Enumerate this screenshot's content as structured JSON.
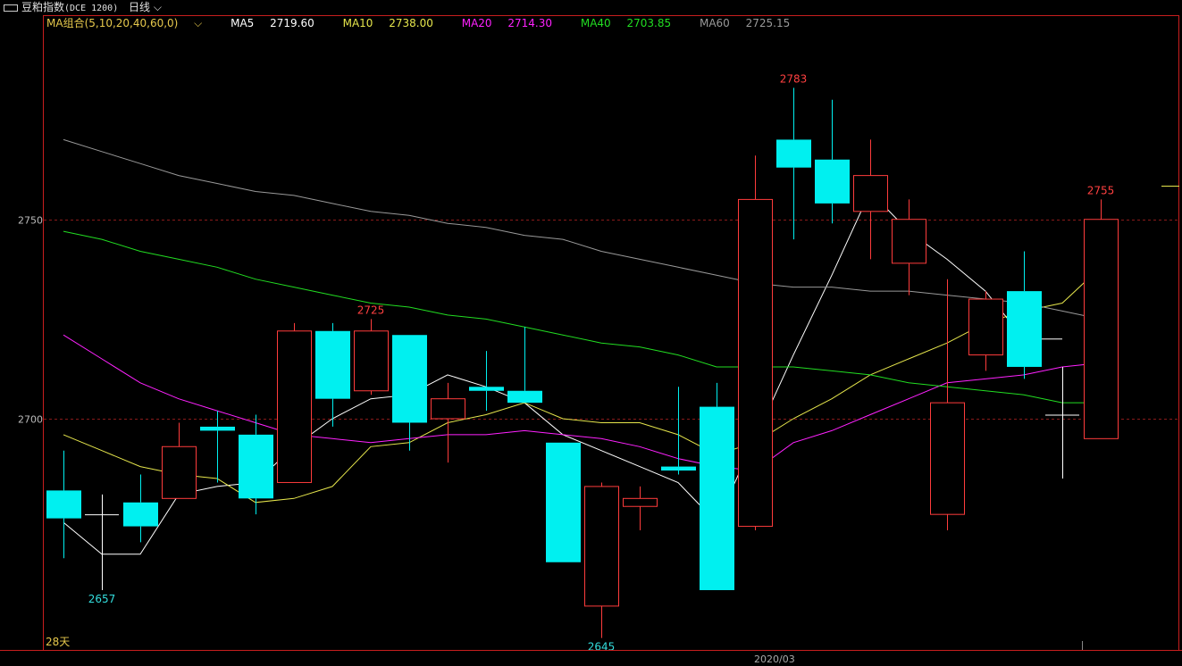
{
  "header": {
    "instrument": "豆粕指数",
    "code": "(DCE 1200)",
    "period": "日线"
  },
  "ma_legend": {
    "group_label": "MA组合(5,10,20,40,60,0)",
    "items": [
      {
        "label": "MA5",
        "value": "2719.60",
        "color": "#ffffff"
      },
      {
        "label": "MA10",
        "value": "2738.00",
        "color": "#e6e64c"
      },
      {
        "label": "MA20",
        "value": "2714.30",
        "color": "#ff22ff"
      },
      {
        "label": "MA40",
        "value": "2703.85",
        "color": "#22dd22"
      },
      {
        "label": "MA60",
        "value": "2725.15",
        "color": "#999999"
      }
    ]
  },
  "footer": {
    "days_label": "28天",
    "month_label": "2020/03"
  },
  "chart_data": {
    "type": "candlestick",
    "ylim": [
      2642,
      2801
    ],
    "yticks": [
      2700,
      2750
    ],
    "colors": {
      "up": "#ff3c3c",
      "down": "#00f0f0",
      "doji": "#ffffff",
      "grid": "#8a1a1a",
      "border": "#c81e1e"
    },
    "candles": [
      {
        "open": 2682,
        "high": 2692,
        "low": 2665,
        "close": 2675
      },
      {
        "open": 2676,
        "high": 2681,
        "low": 2657,
        "close": 2676
      },
      {
        "open": 2679,
        "high": 2686,
        "low": 2669,
        "close": 2673
      },
      {
        "open": 2680,
        "high": 2699,
        "low": 2680,
        "close": 2693
      },
      {
        "open": 2698,
        "high": 2702,
        "low": 2684,
        "close": 2697
      },
      {
        "open": 2696,
        "high": 2701,
        "low": 2676,
        "close": 2680
      },
      {
        "open": 2684,
        "high": 2724,
        "low": 2684,
        "close": 2722
      },
      {
        "open": 2722,
        "high": 2724,
        "low": 2698,
        "close": 2705
      },
      {
        "open": 2707,
        "high": 2725,
        "low": 2706,
        "close": 2722
      },
      {
        "open": 2721,
        "high": 2721,
        "low": 2692,
        "close": 2699
      },
      {
        "open": 2700,
        "high": 2709,
        "low": 2689,
        "close": 2705
      },
      {
        "open": 2708,
        "high": 2717,
        "low": 2702,
        "close": 2707
      },
      {
        "open": 2707,
        "high": 2723,
        "low": 2704,
        "close": 2704
      },
      {
        "open": 2694,
        "high": 2694,
        "low": 2664,
        "close": 2664
      },
      {
        "open": 2653,
        "high": 2684,
        "low": 2645,
        "close": 2683
      },
      {
        "open": 2678,
        "high": 2683,
        "low": 2672,
        "close": 2680
      },
      {
        "open": 2688,
        "high": 2708,
        "low": 2686,
        "close": 2687
      },
      {
        "open": 2703,
        "high": 2709,
        "low": 2657,
        "close": 2657
      },
      {
        "open": 2673,
        "high": 2766,
        "low": 2672,
        "close": 2755
      },
      {
        "open": 2770,
        "high": 2783,
        "low": 2745,
        "close": 2763
      },
      {
        "open": 2765,
        "high": 2780,
        "low": 2749,
        "close": 2754
      },
      {
        "open": 2752,
        "high": 2770,
        "low": 2740,
        "close": 2761
      },
      {
        "open": 2739,
        "high": 2755,
        "low": 2731,
        "close": 2750
      },
      {
        "open": 2676,
        "high": 2735,
        "low": 2672,
        "close": 2704
      },
      {
        "open": 2716,
        "high": 2732,
        "low": 2712,
        "close": 2730
      },
      {
        "open": 2732,
        "high": 2742,
        "low": 2710,
        "close": 2713
      },
      {
        "open": 2701,
        "high": 2713,
        "low": 2685,
        "close": 2701
      },
      {
        "open": 2695,
        "high": 2755,
        "low": 2695,
        "close": 2750
      }
    ],
    "ma": {
      "MA5": [
        2674,
        2666,
        2666,
        2681,
        2683,
        2684,
        2693,
        2700,
        2705,
        2706,
        2711,
        2708,
        2704,
        2696,
        2692,
        2688,
        2684,
        2674,
        2695,
        2716,
        2736,
        2757,
        2747,
        2740,
        2732,
        2720,
        2720
      ],
      "MA10": [
        2696,
        2692,
        2688,
        2686,
        2685,
        2679,
        2680,
        2683,
        2693,
        2694,
        2699,
        2701,
        2704,
        2700,
        2699,
        2699,
        2696,
        2691,
        2694,
        2700,
        2705,
        2711,
        2715,
        2719,
        2724,
        2727,
        2729,
        2738
      ],
      "MA20": [
        2721,
        2715,
        2709,
        2705,
        2702,
        2699,
        2696,
        2695,
        2694,
        2695,
        2696,
        2696,
        2697,
        2696,
        2695,
        2693,
        2690,
        2688,
        2687,
        2694,
        2697,
        2701,
        2705,
        2709,
        2710,
        2711,
        2713,
        2714
      ],
      "MA40": [
        2747,
        2745,
        2742,
        2740,
        2738,
        2735,
        2733,
        2731,
        2729,
        2728,
        2726,
        2725,
        2723,
        2721,
        2719,
        2718,
        2716,
        2713,
        2713,
        2713,
        2712,
        2711,
        2709,
        2708,
        2707,
        2706,
        2704,
        2704
      ],
      "MA60": [
        2770,
        2767,
        2764,
        2761,
        2759,
        2757,
        2756,
        2754,
        2752,
        2751,
        2749,
        2748,
        2746,
        2745,
        2742,
        2740,
        2738,
        2736,
        2734,
        2733,
        2733,
        2732,
        2732,
        2731,
        2730,
        2729,
        2727,
        2725
      ]
    },
    "annotations": [
      {
        "index": 1,
        "value": 2657,
        "label": "2657",
        "color": "#33dddd",
        "pos": "below"
      },
      {
        "index": 8,
        "value": 2725,
        "label": "2725",
        "color": "#ff4040",
        "pos": "above"
      },
      {
        "index": 14,
        "value": 2645,
        "label": "2645",
        "color": "#33dddd",
        "pos": "below"
      },
      {
        "index": 19,
        "value": 2783,
        "label": "2783",
        "color": "#ff4040",
        "pos": "above"
      },
      {
        "index": 27,
        "value": 2755,
        "label": "2755",
        "color": "#ff4040",
        "pos": "above"
      }
    ]
  }
}
